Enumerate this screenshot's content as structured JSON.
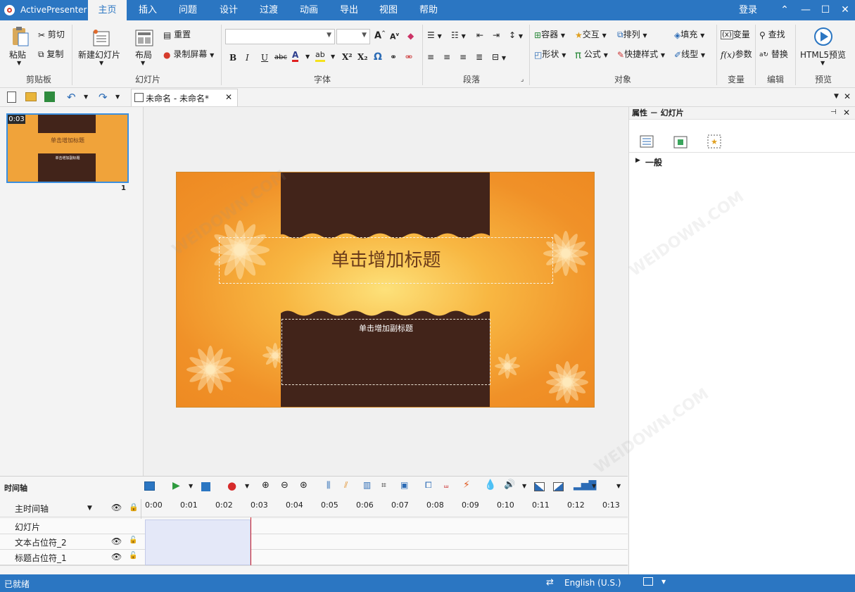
{
  "app": {
    "name": "ActivePresenter"
  },
  "tabs": [
    "主页",
    "插入",
    "问题",
    "设计",
    "过渡",
    "动画",
    "导出",
    "视图",
    "帮助"
  ],
  "login": "登录",
  "ribbon": {
    "clipboard": {
      "paste": "粘贴",
      "cut": "剪切",
      "copy": "复制",
      "label": "剪贴板"
    },
    "slides": {
      "new_slide": "新建幻灯片",
      "layout": "布局",
      "reset": "重置",
      "record": "录制屏幕",
      "label": "幻灯片"
    },
    "font": {
      "label": "字体",
      "bold": "B",
      "italic": "I",
      "underline": "U",
      "strike": "abc",
      "sup": "X²",
      "sub": "X₂",
      "omega": "Ω"
    },
    "paragraph": {
      "label": "段落"
    },
    "object": {
      "container": "容器",
      "interaction": "交互",
      "arrange": "排列",
      "fill": "填充",
      "shape": "形状",
      "formula": "公式",
      "quick_style": "快捷样式",
      "line": "线型",
      "label": "对象"
    },
    "variable": {
      "variable": "变量",
      "param": "参数",
      "label": "变量"
    },
    "edit": {
      "find": "查找",
      "replace": "替换",
      "label": "编辑"
    },
    "preview": {
      "html5": "HTML5预览",
      "label": "预览"
    }
  },
  "document_tab": {
    "title": "未命名 - 未命名*"
  },
  "thumbnail": {
    "duration": "0:03",
    "number": "1",
    "title": "单击增加标题",
    "subtitle": "单击增加副标题"
  },
  "slide": {
    "title": "单击增加标题",
    "subtitle": "单击增加副标题"
  },
  "properties": {
    "header": "属性 － 幻灯片",
    "section": "一般"
  },
  "timeline": {
    "label": "时间轴",
    "main": "主时间轴",
    "ticks": [
      "0:00",
      "0:01",
      "0:02",
      "0:03",
      "0:04",
      "0:05",
      "0:06",
      "0:07",
      "0:08",
      "0:09",
      "0:10",
      "0:11",
      "0:12",
      "0:13"
    ],
    "rows": [
      "幻灯片",
      "文本占位符_2",
      "标题占位符_1"
    ]
  },
  "status": {
    "text": "已就绪",
    "language": "English (U.S.)"
  },
  "watermark": "WEIDOWN.COM"
}
